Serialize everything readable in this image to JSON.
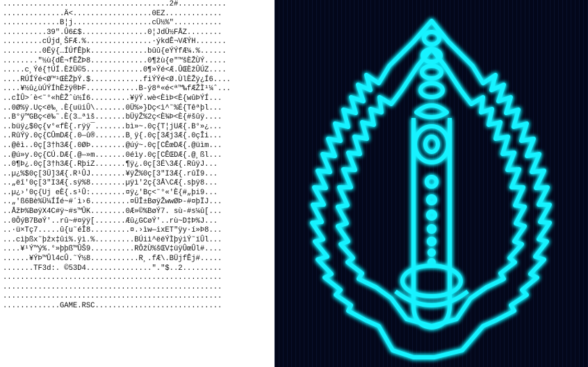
{
  "ascii_panel": {
    "lines": [
      "......................................2#...........",
      "..............Ä<..................0EZ.............",
      ".............B¦j..................cÜ½%\"...........",
      "..........39\".Û6£$...............0¦JdÜ½FÅZ........",
      ".........cÚjd¸ŠFÆ.%...............·ýkdÊ¬VÆÝH.......",
      ".........0Ëÿ{…ÍÚfÊþk.............bûû{eÝÝfÆ¼.%......",
      "........\"½ù{dÊ¬fÊŽÞ8.............0¶žù{e\"™šÈŽÙÝ.....",
      ".....c¸Ýé{†ÚÍ.ÈžÜ©5.............0¶»Ýé<Æ.ÛŒÈžÛÚZ....",
      "....RÚÍÝé<Ø™¹ŒÈŽþÝ.$............fiÝÝé<Ø.ÙlÈŽÿ¿Í6....",
      "....¥½û¿ùÚÝÍhÈžÿ®ÞF............B-ý8ª«é<ª™‰fÆŽÌ¹¼ˆ...",
      "..cÌÛ>´è<˜°«hÈŽˆù½Í6.........¥ÿÝ.wè<ÈìÞ<È{wûÞÝÍ...",
      "..0Ø%ÿ.Uç<ë‰¸.È{uüiÛ\\.......0Ü%»}Dç<ì^˜%É{Têªþl...",
      "..B°ÿ™GBç<ë‰˜.È(3…ªìš.......bÜÿŽ%2ç<È¾Þ<È{#šûÿ....",
      "..büÿ¿$0ç{v°«fÈ{.rÿÿ¯.......bì»~.0ç{T¦jUÆ{.B°»¿...",
      "..RûÝÿ.0ç{CÛmDÆ{.0—û®.......B¸ÿ{.0ç[3Æj3Æ{.0çÎi...",
      "..@êì..0ç[3†h3Æ{.0ØÞ........@úý~.0ç[CÊœDÆ{.@üìm...",
      "..@ú»y.0ç{CÚ.DÆ{.@—»m.......0éìy.0ç[CÊŒDÆ{.@¸ßl...",
      "..0¶Þ¿.0ç[3†h3Æ{.RþiZ.......¶ÿ¿.0ç[3É\\3Æ{.RûÿJ...",
      "..µ¿%$0ç[3Ü]3Æ{.R¹ÛJ........¥ÿŽ%0ç[3\"I3Æ{.rûÏ9...",
      "..„ëî'0ç[3\"I3Æ{.sÿ%8........µÿì'2ç{3Å\\CÆ{.sþÿ8...",
      "..µ¿›'0ç{Uj eÈ{.s¹Û:........¤ÿ¿'Bç<˜°«'È{#„þi9...",
      "..„'ß6Bè%Ü¼ÍÍé~#´ì›6.........¤ÜÎ±BøÿŽwwØÞ-#¤þÏJ...",
      "..ÅžÞ%BøÿX4C#ÿ~#s™ÛK........0Æ»©%BøÝ7. sù-#s¼û[...",
      "..0ÔýB7BøÝ'..rû~#¤ÿÿ[.......Æû¿GCøÝ'..rù~D‡Þ%J...",
      "..·ü×Tç7.....û{u˜éÎ8.........¤.›ìw—ixET\"ÿy·í»Þ8...",
      "...cìþßx˜þžx‡ûi%.ÿì.%.........BÚiì^ëëÝÌþýìÝ˜ïÛl...",
      "....¥¹Ý™ý%.°»þþß™ÛŠ9..........RÔžÙ%šŒV‡üÿÛœÛl#....",
      "......¥ÝÞ™Ûl4cÛ.˜Ý½8...........R¸.fÆ\\.BÜjfÊj#.....",
      ".......TF3d:. ©53D4...............\".\"$..2.........",
      "..................................................",
      "..................................................",
      "..................................................",
      ".............GAME.RSC............................."
    ]
  },
  "glyph_panel": {
    "glow_color": "#19f2ff",
    "background_color": "#03071a",
    "icon": "segmented-crest-icon"
  }
}
